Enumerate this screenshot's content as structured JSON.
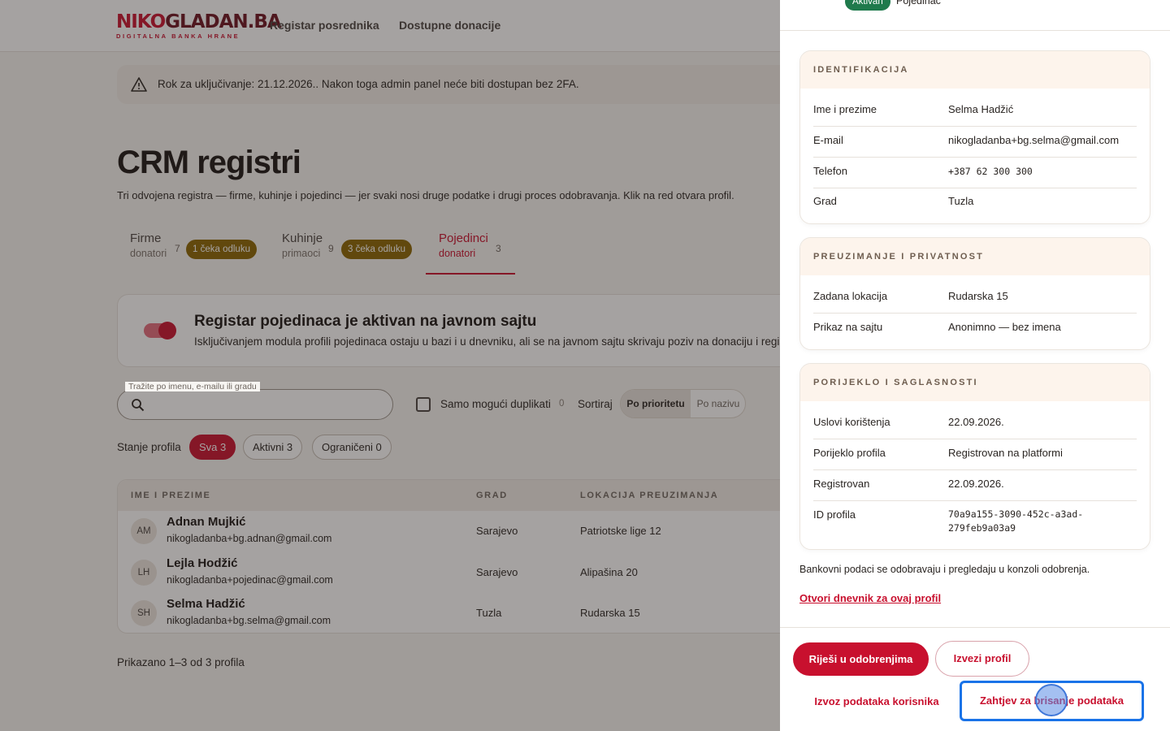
{
  "logo": {
    "main_a": "NIKO",
    "main_b": "GLADAN.BA",
    "sub": "DIGITALNA BANKA HRANE"
  },
  "nav": [
    "Registar posrednika",
    "Dostupne donacije"
  ],
  "alert": {
    "text": "Rok za uključivanje: 21.12.2026.. Nakon toga admin panel neće biti dostupan bez 2FA."
  },
  "page": {
    "title": "CRM registri",
    "subtitle": "Tri odvojena registra — firme, kuhinje i pojedinci — jer svaki nosi druge podatke i drugi proces odobravanja. Klik na red otvara profil."
  },
  "tabs": [
    {
      "name": "Firme",
      "sub": "donatori",
      "count": "7",
      "badge": "1 čeka odluku"
    },
    {
      "name": "Kuhinje",
      "sub": "primaoci",
      "count": "9",
      "badge": "3 čeka odluku"
    },
    {
      "name": "Pojedinci",
      "sub": "donatori",
      "count": "3",
      "badge": ""
    }
  ],
  "module": {
    "title": "Registar pojedinaca je aktivan na javnom sajtu",
    "desc": "Isključivanjem modula profili pojedinaca ostaju u bazi i u dnevniku, ali se na javnom sajtu skrivaju poziv na donaciju i regis"
  },
  "search": {
    "label": "Tražite po imenu, e-mailu ili gradu",
    "value": "",
    "placeholder": ""
  },
  "duplicates": {
    "label": "Samo mogući duplikati",
    "count": "0"
  },
  "sort": {
    "label": "Sortiraj",
    "options": [
      "Po prioritetu",
      "Po nazivu"
    ]
  },
  "filters": {
    "label": "Stanje profila",
    "chips": [
      "Sva 3",
      "Aktivni 3",
      "Ograničeni 0"
    ]
  },
  "table": {
    "headers": [
      "IME I PREZIME",
      "GRAD",
      "LOKACIJA PREUZIMANJA"
    ],
    "rows": [
      {
        "initials": "AM",
        "name": "Adnan Mujkić",
        "email": "nikogladanba+bg.adnan@gmail.com",
        "city": "Sarajevo",
        "location": "Patriotske lige 12"
      },
      {
        "initials": "LH",
        "name": "Lejla Hodžić",
        "email": "nikogladanba+pojedinac@gmail.com",
        "city": "Sarajevo",
        "location": "Alipašina 20"
      },
      {
        "initials": "SH",
        "name": "Selma Hadžić",
        "email": "nikogladanba+bg.selma@gmail.com",
        "city": "Tuzla",
        "location": "Rudarska 15"
      }
    ]
  },
  "pagination": {
    "text": "Prikazano 1–3 od 3 profila"
  },
  "drawer": {
    "status_badge": "Aktivan",
    "type": "Pojedinac",
    "sections": [
      {
        "title": "IDENTIFIKACIJA",
        "rows": [
          {
            "key": "Ime i prezime",
            "value": "Selma Hadžić"
          },
          {
            "key": "E-mail",
            "value": "nikogladanba+bg.selma@gmail.com"
          },
          {
            "key": "Telefon",
            "value": "+387 62 300 300"
          },
          {
            "key": "Grad",
            "value": "Tuzla"
          }
        ]
      },
      {
        "title": "PREUZIMANJE I PRIVATNOST",
        "rows": [
          {
            "key": "Zadana lokacija",
            "value": "Rudarska 15"
          },
          {
            "key": "Prikaz na sajtu",
            "value": "Anonimno — bez imena"
          }
        ]
      },
      {
        "title": "PORIJEKLO I SAGLASNOSTI",
        "rows": [
          {
            "key": "Uslovi korištenja",
            "value": "22.09.2026."
          },
          {
            "key": "Porijeklo profila",
            "value": "Registrovan na platformi"
          },
          {
            "key": "Registrovan",
            "value": "22.09.2026."
          },
          {
            "key": "ID profila",
            "value": "70a9a155-3090-452c-a3ad-279feb9a03a9"
          }
        ]
      }
    ],
    "bank_note": "Bankovni podaci se odobravaju i pregledaju u konzoli odobrenja.",
    "log_link": "Otvori dnevnik za ovaj profil",
    "buttons": {
      "resolve": "Riješi u odobrenjima",
      "export_profile": "Izvezi profil",
      "export_user_data": "Izvoz podataka korisnika",
      "delete_request": "Zahtjev za brisanje podataka"
    }
  },
  "colors": {
    "brand": "#c8102e",
    "warning_badge": "#8a6400",
    "active_badge": "#1f7a4c",
    "focus": "#1a73e8"
  }
}
